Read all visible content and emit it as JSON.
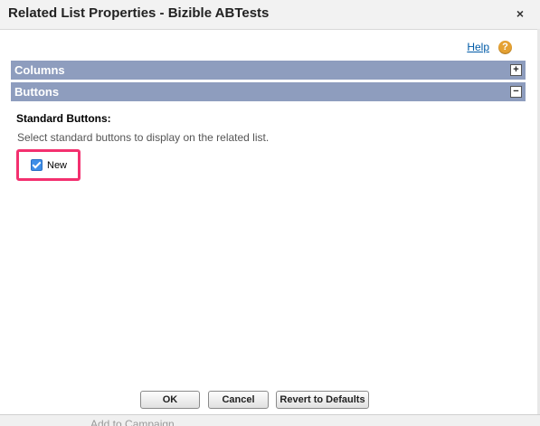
{
  "dialog": {
    "title": "Related List Properties - Bizible ABTests",
    "close_glyph": "×"
  },
  "help": {
    "label": "Help",
    "icon_glyph": "?"
  },
  "sections": {
    "columns": {
      "label": "Columns",
      "toggle": "+",
      "expanded": false
    },
    "buttons": {
      "label": "Buttons",
      "toggle": "−",
      "expanded": true
    }
  },
  "standard_buttons": {
    "title": "Standard Buttons:",
    "description": "Select standard buttons to display on the related list.",
    "options": [
      {
        "label": "New",
        "checked": true
      }
    ]
  },
  "footer": {
    "ok_label": "OK",
    "cancel_label": "Cancel",
    "revert_label": "Revert to Defaults"
  },
  "background": {
    "partial_text": "Add to Campaign"
  },
  "colors": {
    "section_header": "#8e9dbe",
    "highlight": "#f3306f",
    "link": "#015ba7",
    "help_icon": "#e5a132",
    "checkbox": "#3d8ee8"
  }
}
